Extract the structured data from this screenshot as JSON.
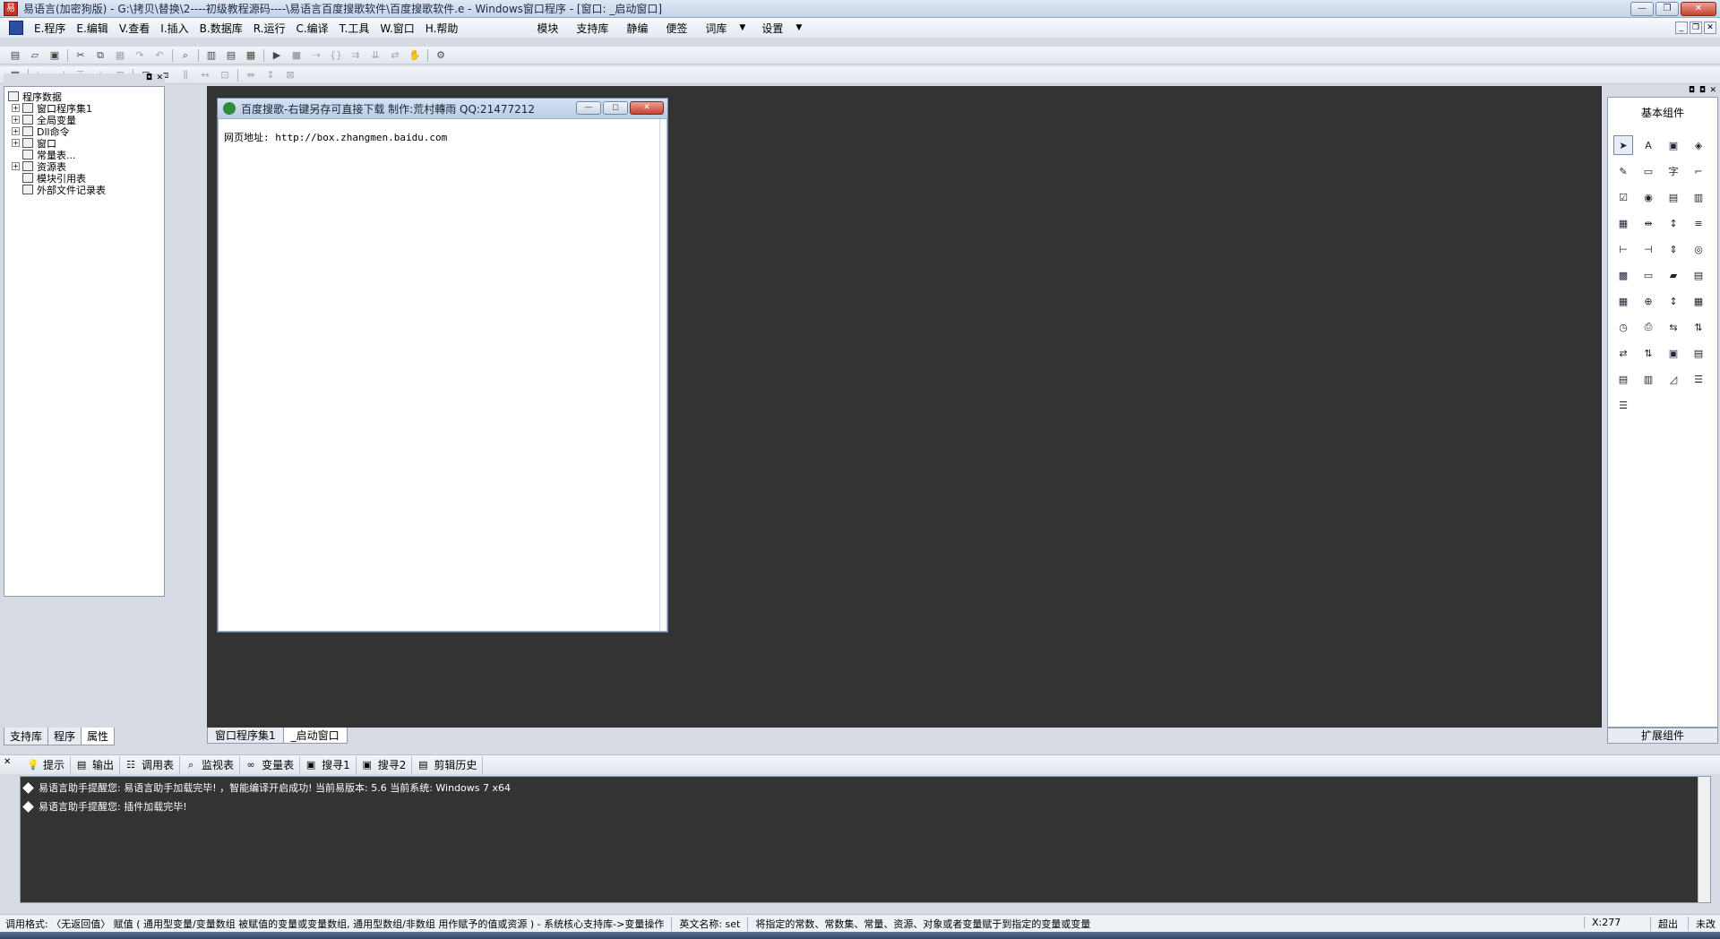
{
  "window": {
    "title": "易语言(加密狗版) - G:\\拷贝\\替换\\2----初级教程源码----\\易语言百度搜歌软件\\百度搜歌软件.e - Windows窗口程序 - [窗口: _启动窗口]",
    "app_icon": "易",
    "minimize": "—",
    "maximize": "❐",
    "close": "✕"
  },
  "menu": {
    "items": [
      "E.程序",
      "E.编辑",
      "V.查看",
      "I.插入",
      "B.数据库",
      "R.运行",
      "C.编译",
      "T.工具",
      "W.窗口",
      "H.帮助"
    ],
    "right_items": [
      "模块",
      "支持库",
      "静编",
      "便签"
    ],
    "dropdowns": [
      "词库",
      "设置"
    ],
    "dropdown_arrow": "▼",
    "mdi_controls": [
      "_",
      "❐",
      "✕"
    ]
  },
  "toolbar1": {
    "buttons": [
      "new-icon",
      "open-icon",
      "save-icon",
      "cut-icon",
      "copy-icon",
      "paste-icon",
      "redo-icon",
      "undo-icon",
      "find-icon",
      "layout1-icon",
      "layout2-icon",
      "layout3-icon",
      "run-icon",
      "stop-icon",
      "step1-icon",
      "step2-icon",
      "step3-icon",
      "step4-icon",
      "step5-icon",
      "hand-icon",
      "debug-icon"
    ],
    "glyphs": [
      "▤",
      "▱",
      "▣",
      "✂",
      "⧉",
      "▦",
      "↷",
      "↶",
      "⌕",
      "▥",
      "▤",
      "▦",
      "▶",
      "■",
      "⇢",
      "{}",
      "⇉",
      "⇊",
      "⇄",
      "✋",
      "⚙"
    ]
  },
  "toolbar2": {
    "buttons": [
      "grid-icon",
      "align-left-icon",
      "align-center-icon",
      "align-top-icon",
      "align-middle-icon",
      "align-bottom-icon",
      "size-width-icon",
      "size-height-icon",
      "size-both-icon",
      "hspace-icon",
      "vspace-icon",
      "center-h-icon",
      "center-v-icon",
      "lock-icon"
    ],
    "glyphs": [
      "▦",
      "⊢",
      "⊣",
      "⊤",
      "⊥",
      "⊞",
      "⊟",
      "⧈",
      "⫼",
      "↔",
      "⊡",
      "⇹",
      "↕",
      "⊠"
    ]
  },
  "left_panel": {
    "root": "程序数据",
    "items": [
      {
        "label": "窗口程序集1",
        "expandable": true
      },
      {
        "label": "全局变量",
        "expandable": true
      },
      {
        "label": "Dll命令",
        "expandable": true
      },
      {
        "label": "窗口",
        "expandable": true
      },
      {
        "label": "常量表...",
        "expandable": false
      },
      {
        "label": "资源表",
        "expandable": true
      },
      {
        "label": "模块引用表",
        "expandable": false
      },
      {
        "label": "外部文件记录表",
        "expandable": false
      }
    ],
    "tabs": [
      "支持库",
      "程序",
      "属性"
    ],
    "active_tab": "属性",
    "header_controls": [
      "◘",
      "✕"
    ]
  },
  "sub_window": {
    "title": "百度搜歌-右键另存可直接下载   制作:荒村轉雨 QQ:21477212",
    "label_text": "网页地址: http://box.zhangmen.baidu.com",
    "controls": [
      "—",
      "◻",
      "✕"
    ]
  },
  "doc_tabs": [
    "窗口程序集1",
    "_启动窗口"
  ],
  "active_doc_tab": "_启动窗口",
  "right_panel": {
    "title": "基本组件",
    "footer": "扩展组件",
    "header_controls": [
      "◘",
      "◘",
      "✕"
    ],
    "components": [
      "➤",
      "A",
      "▣",
      "◈",
      "✎",
      "▭",
      "字",
      "⌐",
      "☑",
      "◉",
      "▤",
      "▥",
      "▦",
      "⇹",
      "↕",
      "≡",
      "⊢",
      "⊣",
      "⇕",
      "◎",
      "▩",
      "▭",
      "▰",
      "▤",
      "▦",
      "⊕",
      "↕",
      "▦",
      "◷",
      "⎙",
      "⇆",
      "⇅",
      "⇄",
      "⇅",
      "▣",
      "▤",
      "▤",
      "▥",
      "◿",
      "☰",
      "☰"
    ],
    "selected_component": "➤"
  },
  "output": {
    "tabs": [
      {
        "label": "提示",
        "icon": "💡"
      },
      {
        "label": "输出",
        "icon": "▤"
      },
      {
        "label": "调用表",
        "icon": "☷"
      },
      {
        "label": "监视表",
        "icon": "⌕"
      },
      {
        "label": "变量表",
        "icon": "∞"
      },
      {
        "label": "搜寻1",
        "icon": "▣"
      },
      {
        "label": "搜寻2",
        "icon": "▣"
      },
      {
        "label": "剪辑历史",
        "icon": "▤"
      }
    ],
    "close": "✕",
    "lines": [
      "易语言助手提醒您: 易语言助手加载完毕! ，智能编译开启成功! 当前易版本: 5.6 当前系统: Windows 7 x64",
      "易语言助手提醒您: 插件加载完毕!"
    ]
  },
  "statusbar": {
    "segments": [
      "调用格式: 〈无返回值〉 赋值 ( 通用型变量/变量数组 被赋值的变量或变量数组, 通用型数组/非数组 用作赋予的值或资源 ) - 系统核心支持库->变量操作",
      "英文名称: set",
      "将指定的常数、常数集、常量、资源、对象或者变量赋于到指定的变量或变量"
    ],
    "coord": "X:277",
    "mode": "超出",
    "extra": "未改"
  }
}
